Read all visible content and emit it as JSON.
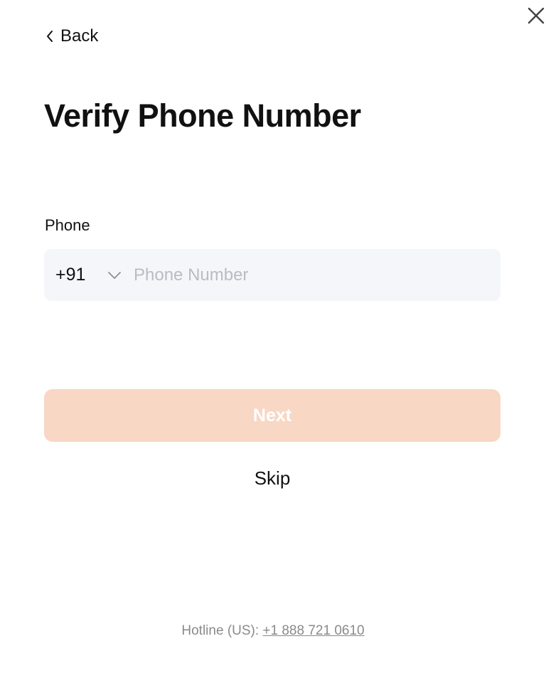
{
  "header": {
    "back_label": "Back",
    "close_icon": "close-icon",
    "back_icon": "chevron-left-icon"
  },
  "page": {
    "title": "Verify Phone Number"
  },
  "form": {
    "phone_label": "Phone",
    "country_code": "+91",
    "phone_value": "",
    "phone_placeholder": "Phone Number",
    "chevron_icon": "chevron-down-icon"
  },
  "actions": {
    "next_label": "Next",
    "skip_label": "Skip"
  },
  "footer": {
    "hotline_prefix": "Hotline (US): ",
    "hotline_number": "+1 888 721 0610"
  },
  "colors": {
    "next_button_bg": "#f8d7c4",
    "field_bg": "#f5f6f9",
    "text_primary": "#111111",
    "text_muted": "#8a8a8a"
  }
}
